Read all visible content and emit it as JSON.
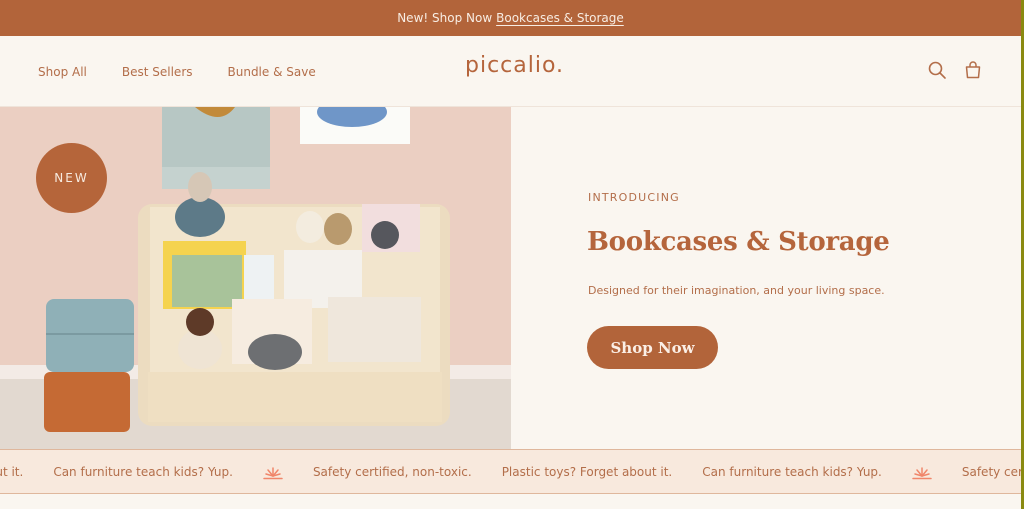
{
  "announcement": {
    "prefix": "New! Shop Now",
    "link": "Bookcases & Storage"
  },
  "header": {
    "nav": [
      {
        "label": "Shop All"
      },
      {
        "label": "Best Sellers"
      },
      {
        "label": "Bundle & Save"
      }
    ],
    "logo": "piccalio.",
    "icons": [
      "search-icon",
      "shopping-bag-icon"
    ]
  },
  "hero": {
    "badge": "NEW",
    "eyebrow": "INTRODUCING",
    "title": "Bookcases & Storage",
    "subtitle": "Designed for their imagination, and your living space.",
    "cta": "Shop Now",
    "image_alt": "Wooden kids bookcase with books, plush toys and storage boxes"
  },
  "marquee": {
    "items": [
      "out it.",
      "Can furniture teach kids? Yup.",
      "Safety certified, non-toxic.",
      "Plastic toys? Forget about it.",
      "Can furniture teach kids? Yup.",
      "Safety certified, non-toxic."
    ],
    "separator_icon": "sunburst-icon"
  },
  "colors": {
    "brand": "#b2643a",
    "background": "#faf6f0",
    "text_accent": "#b36e4a",
    "marquee_bg": "#f8e9dd",
    "sunburst": "#f0866a"
  }
}
